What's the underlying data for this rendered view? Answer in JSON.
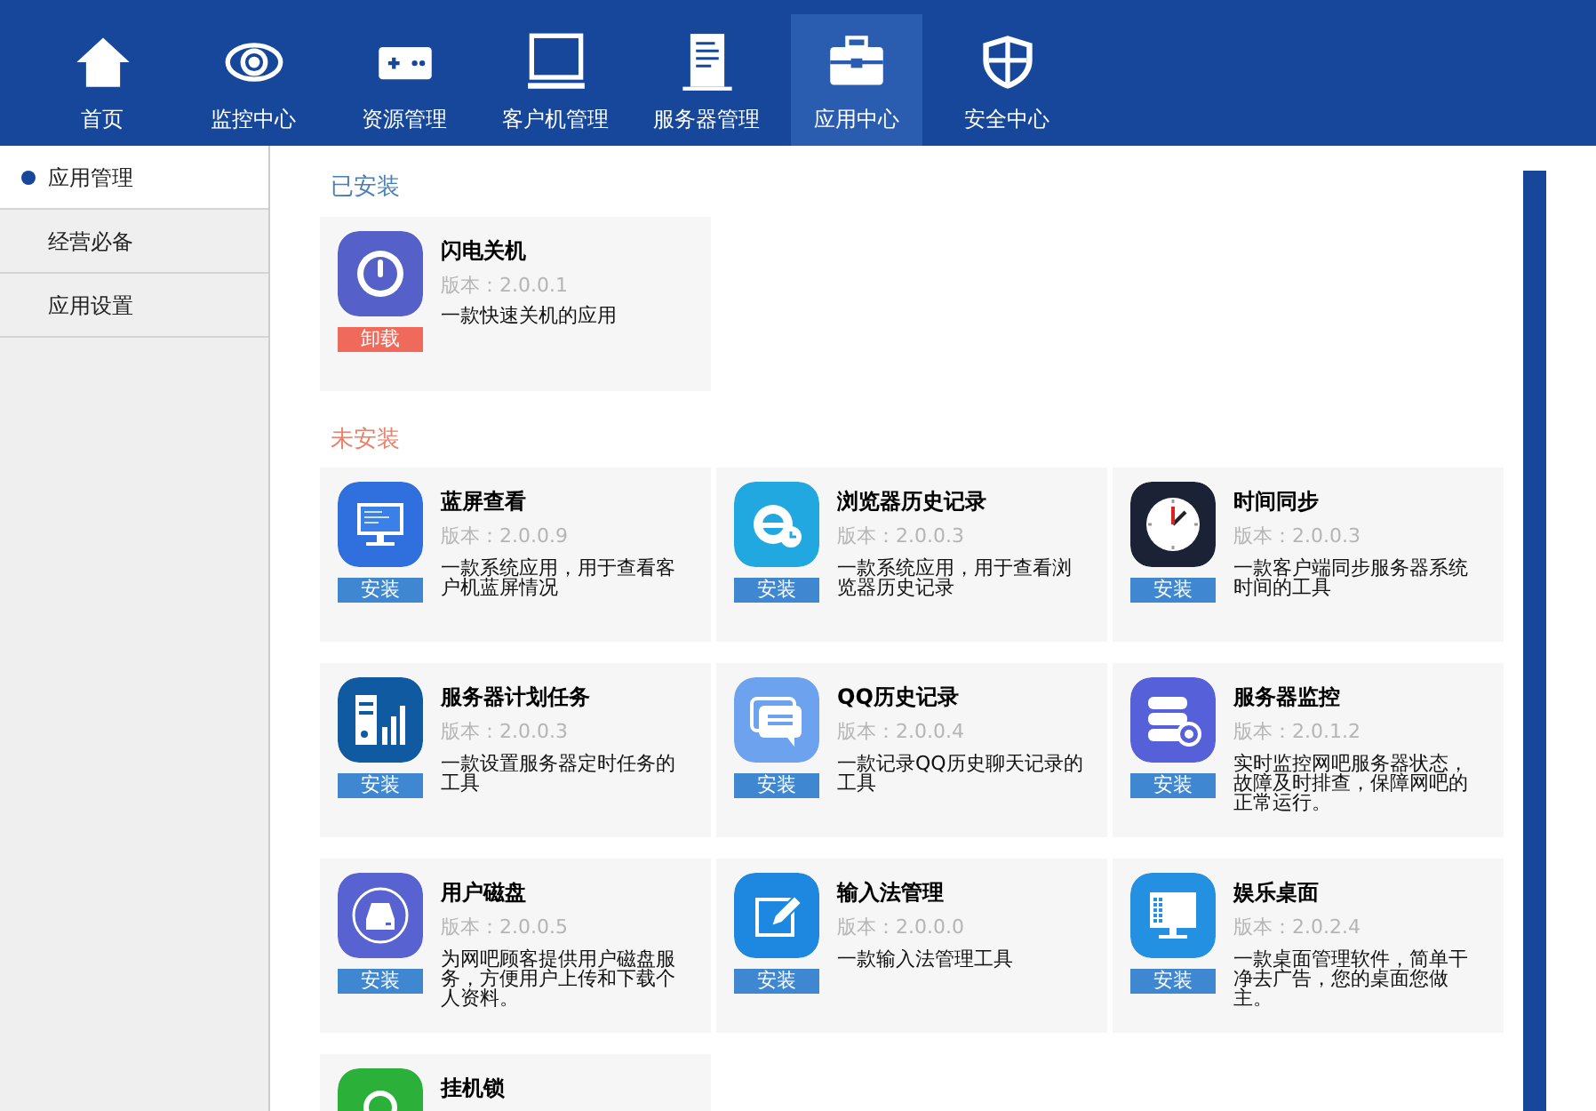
{
  "nav": [
    {
      "label": "首页",
      "kind": "home",
      "selected": false
    },
    {
      "label": "监控中心",
      "kind": "eye",
      "selected": false
    },
    {
      "label": "资源管理",
      "kind": "gamepad",
      "selected": false
    },
    {
      "label": "客户机管理",
      "kind": "monitor",
      "selected": false
    },
    {
      "label": "服务器管理",
      "kind": "server",
      "selected": false
    },
    {
      "label": "应用中心",
      "kind": "toolbox",
      "selected": true
    },
    {
      "label": "安全中心",
      "kind": "shield",
      "selected": false
    }
  ],
  "sidebar": {
    "items": [
      {
        "label": "应用管理",
        "selected": true
      },
      {
        "label": "经营必备",
        "selected": false
      },
      {
        "label": "应用设置",
        "selected": false
      }
    ]
  },
  "sections": [
    {
      "title": "已安装",
      "kind": "installed",
      "apps": [
        {
          "name": "闪电关机",
          "kind": "power",
          "version": "版本：2.0.0.1",
          "description": "一款快速关机的应用",
          "button": "卸载"
        }
      ]
    },
    {
      "title": "未安装",
      "kind": "uninstalled",
      "apps": [
        {
          "name": "蓝屏查看",
          "kind": "monitor",
          "version": "版本：2.0.0.9",
          "description": "一款系统应用，用于查看客户机蓝屏情况",
          "button": "安装"
        },
        {
          "name": "浏览器历史记录",
          "kind": "browser",
          "version": "版本：2.0.0.3",
          "description": "一款系统应用，用于查看浏览器历史记录",
          "button": "安装"
        },
        {
          "name": "时间同步",
          "kind": "clock",
          "version": "版本：2.0.0.3",
          "description": "一款客户端同步服务器系统时间的工具",
          "button": "安装"
        },
        {
          "name": "服务器计划任务",
          "kind": "serverchart",
          "version": "版本：2.0.0.3",
          "description": "一款设置服务器定时任务的工具",
          "button": "安装"
        },
        {
          "name": "QQ历史记录",
          "kind": "chat",
          "version": "版本：2.0.0.4",
          "description": "一款记录QQ历史聊天记录的工具",
          "button": "安装"
        },
        {
          "name": "服务器监控",
          "kind": "servermon",
          "version": "版本：2.0.1.2",
          "description": "实时监控网吧服务器状态，故障及时排查，保障网吧的正常运行。",
          "button": "安装"
        },
        {
          "name": "用户磁盘",
          "kind": "disk",
          "version": "版本：2.0.0.5",
          "description": "为网吧顾客提供用户磁盘服务，方便用户上传和下载个人资料。",
          "button": "安装"
        },
        {
          "name": "输入法管理",
          "kind": "pen",
          "version": "版本：2.0.0.0",
          "description": "一款输入法管理工具",
          "button": "安装"
        },
        {
          "name": "娱乐桌面",
          "kind": "desktop",
          "version": "版本：2.0.2.4",
          "description": "一款桌面管理软件，简单干净去广告，您的桌面您做主。",
          "button": "安装"
        },
        {
          "name": "挂机锁",
          "kind": "lock"
        }
      ]
    }
  ]
}
